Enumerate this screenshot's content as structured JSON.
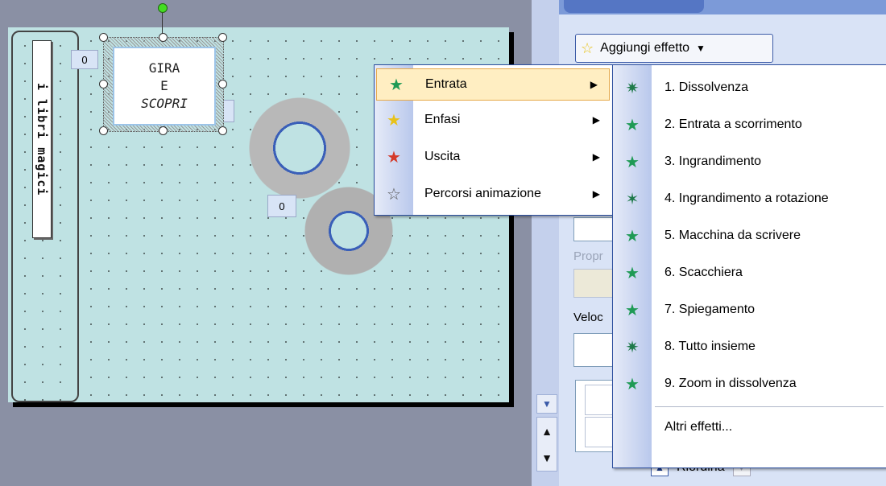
{
  "slide": {
    "vertical_title": "i libri magici",
    "box_lines": [
      "GIRA",
      "E",
      "SCOPRI"
    ],
    "tags": [
      "0",
      "0",
      "0"
    ]
  },
  "taskpane": {
    "add_effect_label": "Aggiungi effetto",
    "prop_label": "Propr",
    "speed_label": "Veloc",
    "reorder_label": "Riordina"
  },
  "menu": {
    "items": [
      {
        "label": "Entrata",
        "icon": "entrance-star-icon",
        "color": "#1f9a55"
      },
      {
        "label": "Enfasi",
        "icon": "emphasis-star-icon",
        "color": "#e8c21a"
      },
      {
        "label": "Uscita",
        "icon": "exit-star-icon",
        "color": "#d43a2a"
      },
      {
        "label": "Percorsi animazione",
        "icon": "motion-path-star-icon",
        "color": "#ffffff"
      }
    ]
  },
  "submenu": {
    "items": [
      "1. Dissolvenza",
      "2. Entrata a scorrimento",
      "3. Ingrandimento",
      "4. Ingrandimento a rotazione",
      "5. Macchina da scrivere",
      "6. Scacchiera",
      "7. Spiegamento",
      "8. Tutto insieme",
      "9. Zoom in dissolvenza"
    ],
    "more": "Altri effetti..."
  }
}
